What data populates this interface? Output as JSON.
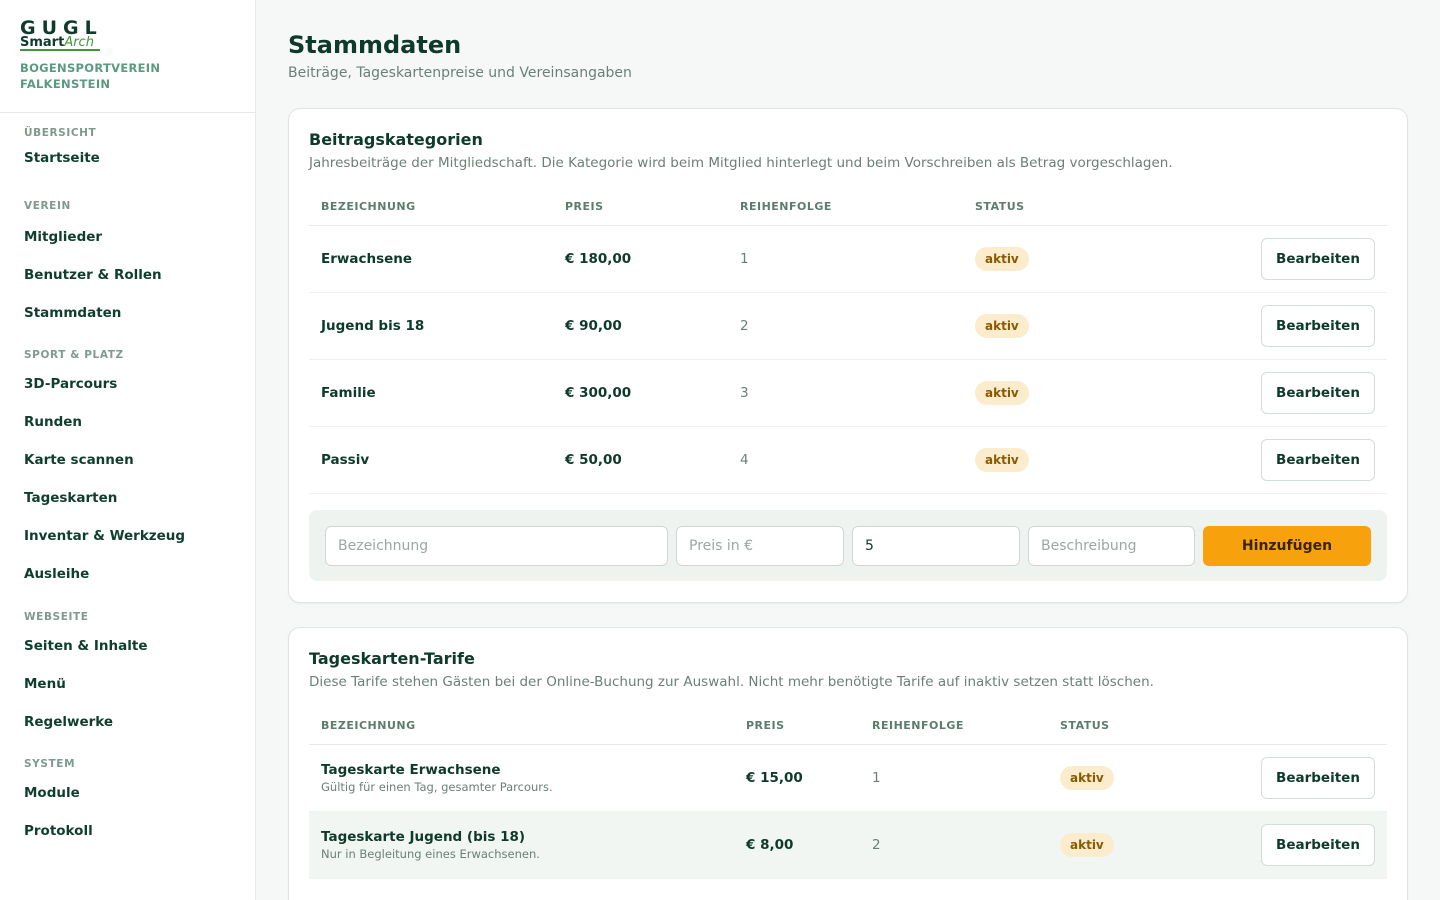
{
  "brand": {
    "logo_top": "GUGL",
    "logo_smart": "Smart",
    "logo_arch": "Arch",
    "club_name": "BOGENSPORTVEREIN FALKENSTEIN"
  },
  "nav": {
    "groups": [
      {
        "label": "ÜBERSICHT",
        "items": [
          "Startseite"
        ]
      },
      {
        "label": "VEREIN",
        "items": [
          "Mitglieder",
          "Benutzer & Rollen",
          "Stammdaten"
        ]
      },
      {
        "label": "SPORT & PLATZ",
        "items": [
          "3D-Parcours",
          "Runden",
          "Karte scannen",
          "Tageskarten",
          "Inventar & Werkzeug",
          "Ausleihe"
        ]
      },
      {
        "label": "WEBSEITE",
        "items": [
          "Seiten & Inhalte",
          "Menü",
          "Regelwerke"
        ]
      },
      {
        "label": "SYSTEM",
        "items": [
          "Module",
          "Protokoll"
        ]
      }
    ]
  },
  "page": {
    "title": "Stammdaten",
    "subtitle": "Beiträge, Tageskartenpreise und Vereinsangaben"
  },
  "beitrag": {
    "title": "Beitragskategorien",
    "desc": "Jahresbeiträge der Mitgliedschaft. Die Kategorie wird beim Mitglied hinterlegt und beim Vorschreiben als Betrag vorgeschlagen.",
    "headers": {
      "name": "BEZEICHNUNG",
      "price": "PREIS",
      "order": "REIHENFOLGE",
      "status": "STATUS"
    },
    "rows": [
      {
        "name": "Erwachsene",
        "price": "€ 180,00",
        "order": "1",
        "status": "aktiv",
        "action": "Bearbeiten"
      },
      {
        "name": "Jugend bis 18",
        "price": "€ 90,00",
        "order": "2",
        "status": "aktiv",
        "action": "Bearbeiten"
      },
      {
        "name": "Familie",
        "price": "€ 300,00",
        "order": "3",
        "status": "aktiv",
        "action": "Bearbeiten"
      },
      {
        "name": "Passiv",
        "price": "€ 50,00",
        "order": "4",
        "status": "aktiv",
        "action": "Bearbeiten"
      }
    ],
    "form": {
      "name_placeholder": "Bezeichnung",
      "price_placeholder": "Preis in €",
      "order_value": "5",
      "desc_placeholder": "Beschreibung",
      "add_label": "Hinzufügen"
    }
  },
  "tarife": {
    "title": "Tageskarten-Tarife",
    "desc": "Diese Tarife stehen Gästen bei der Online-Buchung zur Auswahl. Nicht mehr benötigte Tarife auf inaktiv setzen statt löschen.",
    "headers": {
      "name": "BEZEICHNUNG",
      "price": "PREIS",
      "order": "REIHENFOLGE",
      "status": "STATUS"
    },
    "rows": [
      {
        "name": "Tageskarte Erwachsene",
        "note": "Gültig für einen Tag, gesamter Parcours.",
        "price": "€ 15,00",
        "order": "1",
        "status": "aktiv",
        "action": "Bearbeiten"
      },
      {
        "name": "Tageskarte Jugend (bis 18)",
        "note": "Nur in Begleitung eines Erwachsenen.",
        "price": "€ 8,00",
        "order": "2",
        "status": "aktiv",
        "action": "Bearbeiten"
      }
    ]
  },
  "colors": {
    "primary": "#0e3a2b",
    "accent": "#f7a10d",
    "badge_bg": "#fbeccd",
    "logo_green": "#3d9a3a"
  }
}
